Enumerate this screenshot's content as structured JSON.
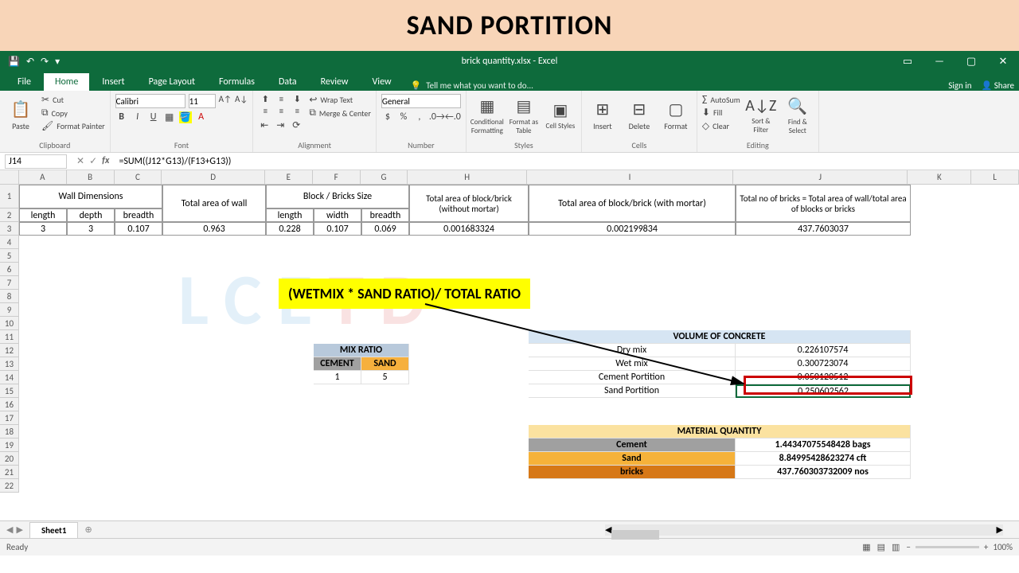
{
  "banner": {
    "title": "SAND PORTITION"
  },
  "app": {
    "doc_title": "brick quantity.xlsx - Excel"
  },
  "qat": {
    "save": "💾",
    "undo": "↶",
    "redo": "↷"
  },
  "win": {
    "ribbon_opts": "▭",
    "min": "—",
    "max": "▢",
    "close": "✕"
  },
  "tabs": {
    "file": "File",
    "home": "Home",
    "insert": "Insert",
    "page_layout": "Page Layout",
    "formulas": "Formulas",
    "data": "Data",
    "review": "Review",
    "view": "View",
    "tell_me": "Tell me what you want to do...",
    "sign_in": "Sign in",
    "share": "Share"
  },
  "ribbon": {
    "clipboard": {
      "paste": "Paste",
      "cut": "Cut",
      "copy": "Copy",
      "format_painter": "Format Painter",
      "label": "Clipboard"
    },
    "font": {
      "name": "Calibri",
      "size": "11",
      "label": "Font"
    },
    "alignment": {
      "wrap": "Wrap Text",
      "merge": "Merge & Center",
      "label": "Alignment"
    },
    "number": {
      "format": "General",
      "label": "Number"
    },
    "styles": {
      "cond": "Conditional Formatting",
      "table": "Format as Table",
      "cell": "Cell Styles",
      "label": "Styles"
    },
    "cells": {
      "insert": "Insert",
      "delete": "Delete",
      "format": "Format",
      "label": "Cells"
    },
    "editing": {
      "autosum": "AutoSum",
      "fill": "Fill",
      "clear": "Clear",
      "sort": "Sort & Filter",
      "find": "Find & Select",
      "label": "Editing"
    }
  },
  "formula_bar": {
    "cell_ref": "J14",
    "formula": "=SUM((J12*G13)/(F13+G13))"
  },
  "columns": [
    "A",
    "B",
    "C",
    "D",
    "E",
    "F",
    "G",
    "H",
    "I",
    "J",
    "K",
    "L"
  ],
  "rows": [
    "1",
    "2",
    "3",
    "4",
    "5",
    "6",
    "7",
    "8",
    "9",
    "10",
    "11",
    "12",
    "13",
    "14",
    "15",
    "16",
    "17",
    "18",
    "19",
    "20",
    "21",
    "22"
  ],
  "headers": {
    "wall_dim": "Wall Dimensions",
    "length": "length",
    "depth": "depth",
    "breadth": "breadth",
    "total_area_wall": "Total area of wall",
    "block_size": "Block / Bricks Size",
    "length2": "length",
    "width": "width",
    "breadth2": "breadth",
    "area_no_mortar": "Total area of block/brick (without mortar)",
    "area_mortar": "Total area of block/brick (with mortar)",
    "total_bricks": "Total no of bricks = Total area of wall/total area of blocks or bricks"
  },
  "row3": {
    "A": "3",
    "B": "3",
    "C": "0.107",
    "D": "0.963",
    "E": "0.228",
    "F": "0.107",
    "G": "0.069",
    "H": "0.001683324",
    "I": "0.002199834",
    "J": "437.7603037"
  },
  "annotation": "(WETMIX * SAND RATIO)/ TOTAL RATIO",
  "mix_ratio": {
    "title": "MIX RATIO",
    "cement_h": "CEMENT",
    "sand_h": "SAND",
    "cement_v": "1",
    "sand_v": "5"
  },
  "volume": {
    "title": "VOLUME OF CONCRETE",
    "dry_mix": "Dry mix",
    "dry_mix_v": "0.226107574",
    "wet_mix": "Wet mix",
    "wet_mix_v": "0.300723074",
    "cement_p": "Cement Portition",
    "cement_p_v": "0.050120512",
    "sand_p": "Sand  Portition",
    "sand_p_v": "0.250602562"
  },
  "material": {
    "title": "MATERIAL QUANTITY",
    "cement": "Cement",
    "cement_v": "1.44347075548428 bags",
    "sand": "Sand",
    "sand_v": "8.84995428623274 cft",
    "bricks": "bricks",
    "bricks_v": "437.760303732009 nos"
  },
  "sheet": {
    "name": "Sheet1",
    "add": "⊕"
  },
  "status": {
    "ready": "Ready",
    "zoom": "100%"
  },
  "watermark": {
    "p1": "LCE",
    "p2": "TD"
  }
}
